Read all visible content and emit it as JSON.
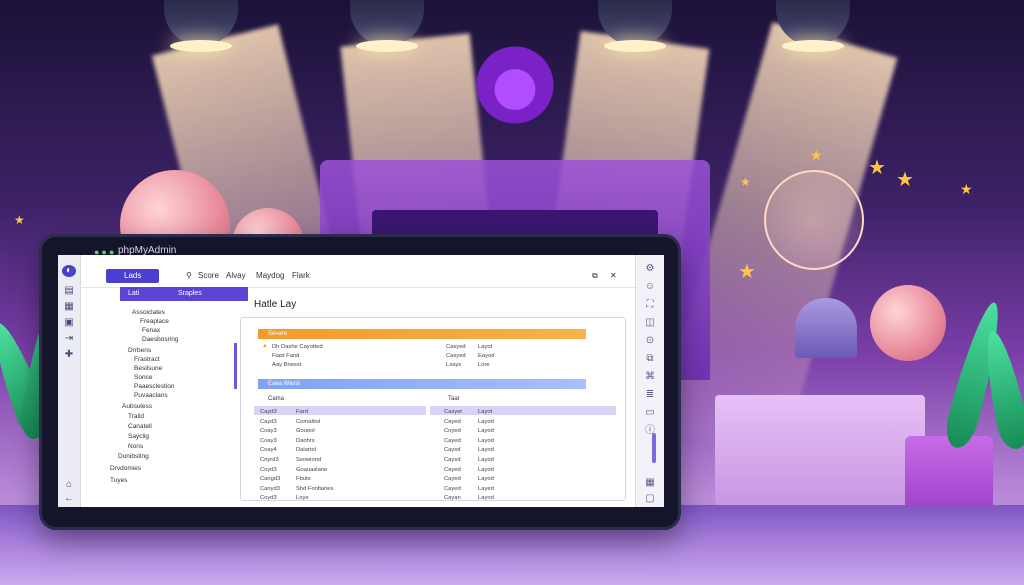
{
  "colors": {
    "accent": "#4b3fcf",
    "orange_bar": "#f39a2a",
    "blue_bar": "#7fa2f5"
  },
  "app": {
    "title": "phpMyAdmin"
  },
  "topnav": {
    "tabs": [
      "Lads",
      "Score",
      "Alvay",
      "Maydog",
      "Flark"
    ]
  },
  "sidebar": {
    "header": [
      "Lati",
      "Sraples"
    ],
    "tree": [
      "Assoiclates",
      "Freaplace",
      "Fenax",
      "Daesbosring",
      "Drrbens",
      "Frastract",
      "Besilsune",
      "Sonce",
      "Paaesclestion",
      "Puvaaclans",
      "Aubsuless",
      "Tralid",
      "Canatell",
      "Sayclig",
      "Nons",
      "Donibsting",
      "Drvdomies",
      "Tuyes"
    ]
  },
  "main": {
    "title": "Hatle Lay",
    "orange_label": "Sevare",
    "blue_label": "Eaea Wavsi",
    "top_left_rows": [
      "Dh Dashe Cayotted",
      "Fiast Fand",
      "Aay Bnesst"
    ],
    "top_right_rows": [
      [
        "Casyed",
        "Layot"
      ],
      [
        "Casyed",
        "Eayod"
      ],
      [
        "Lsays",
        "Lore"
      ]
    ],
    "left_header": "Cama",
    "right_header": "Taar",
    "left_rows": [
      [
        "Cayd3",
        "Fard"
      ],
      [
        "Cayd3",
        "Comaltiol"
      ],
      [
        "Coay3",
        "Goueol"
      ],
      [
        "Coay3",
        "Daohrs"
      ],
      [
        "Coay4",
        "Dalartol"
      ],
      [
        "Coyrd3",
        "Ssowiond"
      ],
      [
        "Coyd3",
        "Goauaslane"
      ],
      [
        "Cangd3",
        "Fbuts"
      ],
      [
        "Canyd3",
        "Shd Fonfiaries"
      ],
      [
        "Coyd3",
        "Loye"
      ]
    ],
    "right_rows": [
      [
        "Casyer",
        "Layot"
      ],
      [
        "Cayed",
        "Layod"
      ],
      [
        "Coyed",
        "Layod"
      ],
      [
        "Cayed",
        "Layod"
      ],
      [
        "Caysd",
        "Layod"
      ],
      [
        "Caysd",
        "Layod"
      ],
      [
        "Cayed",
        "Layod"
      ],
      [
        "Cayed",
        "Layod"
      ],
      [
        "Cayed",
        "Layed"
      ],
      [
        "Cayan",
        "Layod"
      ]
    ]
  },
  "icons": {
    "left_rail": [
      "home-icon",
      "database-icon",
      "table-icon",
      "sql-icon",
      "export-icon",
      "import-icon"
    ],
    "right_rail": [
      "settings-icon",
      "user-icon",
      "lock-icon",
      "chart-icon",
      "key-icon",
      "link-icon",
      "code-icon",
      "list-icon",
      "folder-icon",
      "info-icon"
    ]
  }
}
